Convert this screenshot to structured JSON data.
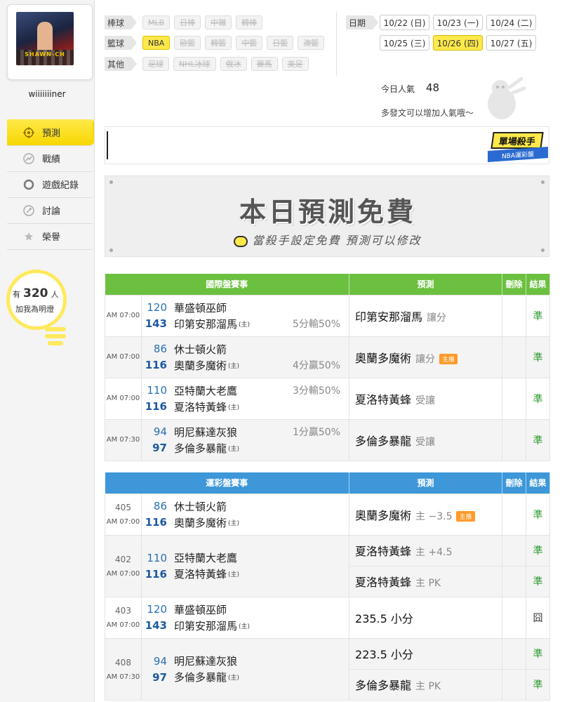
{
  "user": {
    "name": "wiiiiiiiner",
    "avatar_text": "SHAWN-CH"
  },
  "nav": [
    {
      "label": "預測",
      "icon": "target-icon",
      "active": true
    },
    {
      "label": "戰績",
      "icon": "chart-icon",
      "active": false
    },
    {
      "label": "遊戲紀錄",
      "icon": "ring-icon",
      "active": false
    },
    {
      "label": "討論",
      "icon": "discuss-icon",
      "active": false
    },
    {
      "label": "榮譽",
      "icon": "trophy-icon",
      "active": false
    }
  ],
  "fans": {
    "prefix": "有",
    "count": "320",
    "suffix": "人",
    "caption": "加我為明燈"
  },
  "filters": {
    "baseball": {
      "label": "棒球",
      "items": [
        "MLB",
        "日棒",
        "中職",
        "韓棒"
      ]
    },
    "basketball": {
      "label": "籃球",
      "items": [
        "NBA",
        "歐籃",
        "韓籃",
        "中籃",
        "日籃",
        "澳籃"
      ],
      "active": "NBA"
    },
    "other": {
      "label": "其他",
      "items": [
        "足球",
        "NHL冰球",
        "俄冰",
        "賽馬",
        "美足"
      ]
    }
  },
  "dates": {
    "label": "日期",
    "items": [
      "10/22 (日)",
      "10/23 (一)",
      "10/24 (二)",
      "10/25 (三)",
      "10/26 (四)",
      "10/27 (五)"
    ],
    "active": "10/26 (四)"
  },
  "popularity": {
    "label": "今日人氣",
    "value": "48",
    "hint": "多發文可以增加人氣哦～"
  },
  "badge": {
    "title": "單場殺手",
    "subtitle": "NBA運彩盤"
  },
  "banner": {
    "title": "本日預測免費",
    "subtitle": "當殺手設定免費  預測可以修改"
  },
  "intl_table": {
    "headers": {
      "match": "國際盤賽事",
      "pick": "預測",
      "delete": "刪除",
      "result": "結果"
    },
    "rows": [
      {
        "time": "AM 07:00",
        "away_num": "120",
        "away": "華盛頓巫師",
        "home_num": "143",
        "home": "印第安那溜馬",
        "line": "5分輸50%",
        "line_row": "home",
        "pick": "印第安那溜馬",
        "pick_sub": "讓分",
        "hot": "",
        "result": "準"
      },
      {
        "time": "AM 07:00",
        "away_num": "86",
        "away": "休士頓火箭",
        "home_num": "116",
        "home": "奧蘭多魔術",
        "line": "4分贏50%",
        "line_row": "home",
        "pick": "奧蘭多魔術",
        "pick_sub": "讓分",
        "hot": "主推",
        "result": "準"
      },
      {
        "time": "AM 07:00",
        "away_num": "110",
        "away": "亞特蘭大老鷹",
        "home_num": "116",
        "home": "夏洛特黃蜂",
        "line": "3分輸50%",
        "line_row": "away",
        "pick": "夏洛特黃蜂",
        "pick_sub": "受讓",
        "hot": "",
        "result": "準"
      },
      {
        "time": "AM 07:30",
        "away_num": "94",
        "away": "明尼蘇達灰狼",
        "home_num": "97",
        "home": "多倫多暴龍",
        "line": "1分贏50%",
        "line_row": "away",
        "pick": "多倫多暴龍",
        "pick_sub": "受讓",
        "hot": "",
        "result": "準"
      }
    ]
  },
  "lottery_table": {
    "headers": {
      "match": "運彩盤賽事",
      "pick": "預測",
      "delete": "刪除",
      "result": "結果"
    },
    "home_mark": "(主)",
    "rows": [
      {
        "game": "405",
        "time": "AM 07:00",
        "away_num": "86",
        "away": "休士頓火箭",
        "home_num": "116",
        "home": "奧蘭多魔術",
        "picks": [
          {
            "text": "奧蘭多魔術",
            "sub": "主 −3.5",
            "hot": "主推",
            "result": "準"
          }
        ]
      },
      {
        "game": "402",
        "time": "AM 07:00",
        "away_num": "110",
        "away": "亞特蘭大老鷹",
        "home_num": "116",
        "home": "夏洛特黃蜂",
        "picks": [
          {
            "text": "夏洛特黃蜂",
            "sub": "主 +4.5",
            "hot": "",
            "result": "準"
          },
          {
            "text": "夏洛特黃蜂",
            "sub": "主 PK",
            "hot": "",
            "result": "準"
          }
        ]
      },
      {
        "game": "403",
        "time": "AM 07:00",
        "away_num": "120",
        "away": "華盛頓巫師",
        "home_num": "143",
        "home": "印第安那溜馬",
        "picks": [
          {
            "text": "235.5 小分",
            "sub": "",
            "hot": "",
            "result": "囧"
          }
        ]
      },
      {
        "game": "408",
        "time": "AM 07:30",
        "away_num": "94",
        "away": "明尼蘇達灰狼",
        "home_num": "97",
        "home": "多倫多暴龍",
        "picks": [
          {
            "text": "223.5 小分",
            "sub": "",
            "hot": "",
            "result": "準"
          },
          {
            "text": "多倫多暴龍",
            "sub": "主 PK",
            "hot": "",
            "result": "準"
          }
        ]
      }
    ]
  },
  "colors": {
    "accent": "#ffe94a",
    "green_header": "#6cc040",
    "blue_header": "#3d97d8",
    "win": "#2d9a2d",
    "number": "#2a6fb4"
  }
}
